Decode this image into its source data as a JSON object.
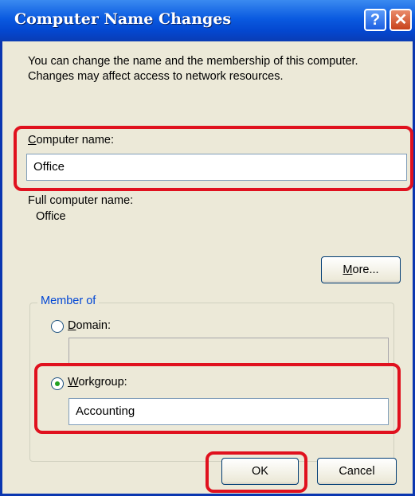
{
  "dialog": {
    "title": "Computer Name Changes",
    "help_label": "?",
    "close_label": "✕",
    "description": "You can change the name and the membership of this computer. Changes may affect access to network resources.",
    "computer_name_label_prefix": "C",
    "computer_name_label_rest": "omputer name:",
    "computer_name_value": "Office",
    "full_name_label": "Full computer name:",
    "full_name_value": "Office",
    "more_button_prefix": "M",
    "more_button_rest": "ore...",
    "member_of_legend": "Member of",
    "domain_label_prefix": "D",
    "domain_label_rest": "omain:",
    "domain_value": "",
    "domain_selected": false,
    "workgroup_label_prefix": "W",
    "workgroup_label_rest": "orkgroup:",
    "workgroup_value": "Accounting",
    "workgroup_selected": true,
    "ok_label": "OK",
    "cancel_label": "Cancel"
  },
  "colors": {
    "titlebar": "#0a5ae0",
    "dialog_bg": "#ece9d8",
    "callout": "#e0111e",
    "legend_text": "#0046d5"
  }
}
